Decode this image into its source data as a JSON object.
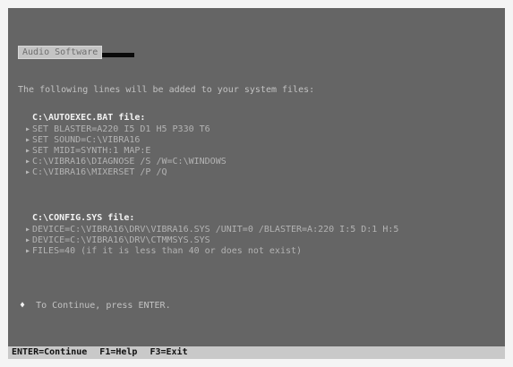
{
  "title": "Audio Software",
  "intro": "The following lines will be added to your system files:",
  "autoexec": {
    "header": "C:\\AUTOEXEC.BAT file:",
    "lines": [
      "SET BLASTER=A220 I5 D1 H5 P330 T6",
      "SET SOUND=C:\\VIBRA16",
      "SET MIDI=SYNTH:1 MAP:E",
      "C:\\VIBRA16\\DIAGNOSE /S /W=C:\\WINDOWS",
      "C:\\VIBRA16\\MIXERSET /P /Q"
    ]
  },
  "config": {
    "header": "C:\\CONFIG.SYS file:",
    "lines": [
      "DEVICE=C:\\VIBRA16\\DRV\\VIBRA16.SYS /UNIT=0 /BLASTER=A:220 I:5 D:1 H:5",
      "DEVICE=C:\\VIBRA16\\DRV\\CTMMSYS.SYS",
      "FILES=40 (if it is less than 40 or does not exist)"
    ]
  },
  "prompt": "To Continue, press ENTER.",
  "status": {
    "enter": "ENTER=Continue",
    "help": "F1=Help",
    "exit": "F3=Exit"
  }
}
